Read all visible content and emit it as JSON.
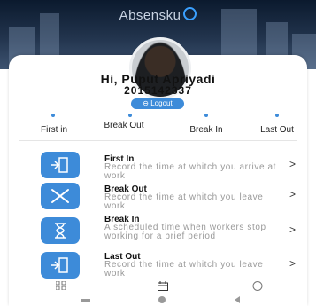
{
  "app": {
    "title": "Absensku"
  },
  "profile": {
    "greeting": "Hi, Puput Apriyadi",
    "id_number": "2015142337",
    "logout_label": "⊖ Logout"
  },
  "status": [
    {
      "label": "First in"
    },
    {
      "label": "Break Out"
    },
    {
      "label": "Break In"
    },
    {
      "label": "Last Out"
    }
  ],
  "menu": [
    {
      "title": "First In",
      "description": "Record the time at whitch you arrive at work",
      "icon": "exit-door-icon"
    },
    {
      "title": "Break Out",
      "description": "Record the time at whitch you leave work",
      "icon": "fork-spoon-icon"
    },
    {
      "title": "Break In",
      "description": "A scheduled time when workers stop working for a brief period",
      "icon": "hourglass-icon"
    },
    {
      "title": "Last Out",
      "description": "Record the time at whitch you leave work",
      "icon": "exit-door-icon"
    }
  ],
  "colors": {
    "accent": "#3d8bd9",
    "header": "#1b2c44"
  },
  "chevron": ">"
}
